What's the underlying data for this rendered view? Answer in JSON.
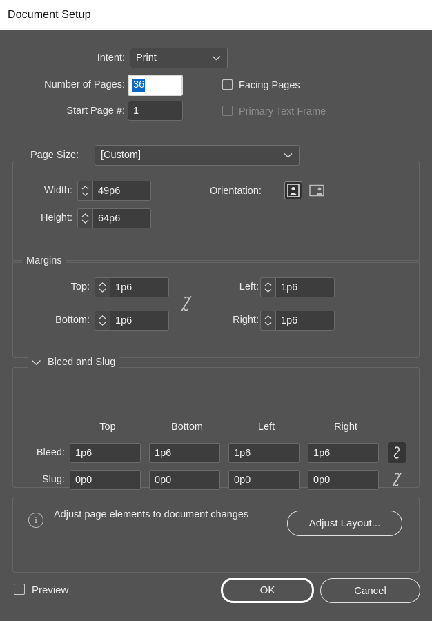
{
  "window": {
    "title": "Document Setup"
  },
  "colors": {
    "dialog_bg": "#535353",
    "titlebar_bg": "#ffffff",
    "field_bg": "#3d3d3d",
    "selection_blue": "#0a69c8",
    "text": "#e9e9e9",
    "disabled_text": "#8d8d8d"
  },
  "intent": {
    "label": "Intent:",
    "value": "Print",
    "chevron_icon": "chevron-down-icon"
  },
  "pages": {
    "number_label": "Number of Pages:",
    "number_value": "36",
    "number_selected": true,
    "start_label": "Start Page #:",
    "start_value": "1",
    "facing_pages_label": "Facing Pages",
    "facing_pages_checked": false,
    "primary_text_frame_label": "Primary Text Frame",
    "primary_text_frame_checked": false,
    "primary_text_frame_disabled": true
  },
  "page_size": {
    "label": "Page Size:",
    "value": "[Custom]",
    "width_label": "Width:",
    "width_value": "49p6",
    "height_label": "Height:",
    "height_value": "64p6",
    "orientation_label": "Orientation:",
    "orientation_portrait_icon": "portrait-orientation-icon",
    "orientation_landscape_icon": "landscape-orientation-icon",
    "orientation_selected": "portrait"
  },
  "margins": {
    "title": "Margins",
    "top_label": "Top:",
    "top_value": "1p6",
    "bottom_label": "Bottom:",
    "bottom_value": "1p6",
    "left_label": "Left:",
    "left_value": "1p6",
    "right_label": "Right:",
    "right_value": "1p6",
    "link_icon": "broken-chain-link-icon",
    "linked": false
  },
  "bleed_slug": {
    "title": "Bleed and Slug",
    "collapse_icon": "chevron-down-icon",
    "expanded": true,
    "columns": [
      "Top",
      "Bottom",
      "Left",
      "Right"
    ],
    "rows": [
      {
        "label": "Bleed:",
        "values": [
          "1p6",
          "1p6",
          "1p6",
          "1p6"
        ],
        "link_icon": "linked-chain-link-icon",
        "linked": true
      },
      {
        "label": "Slug:",
        "values": [
          "0p0",
          "0p0",
          "0p0",
          "0p0"
        ],
        "link_icon": "broken-chain-link-icon",
        "linked": false
      }
    ]
  },
  "adjust_layout": {
    "info_icon": "info-circle-icon",
    "message": "Adjust page elements to document changes",
    "button_label": "Adjust Layout..."
  },
  "footer": {
    "preview_label": "Preview",
    "preview_checked": false,
    "ok_label": "OK",
    "cancel_label": "Cancel"
  }
}
